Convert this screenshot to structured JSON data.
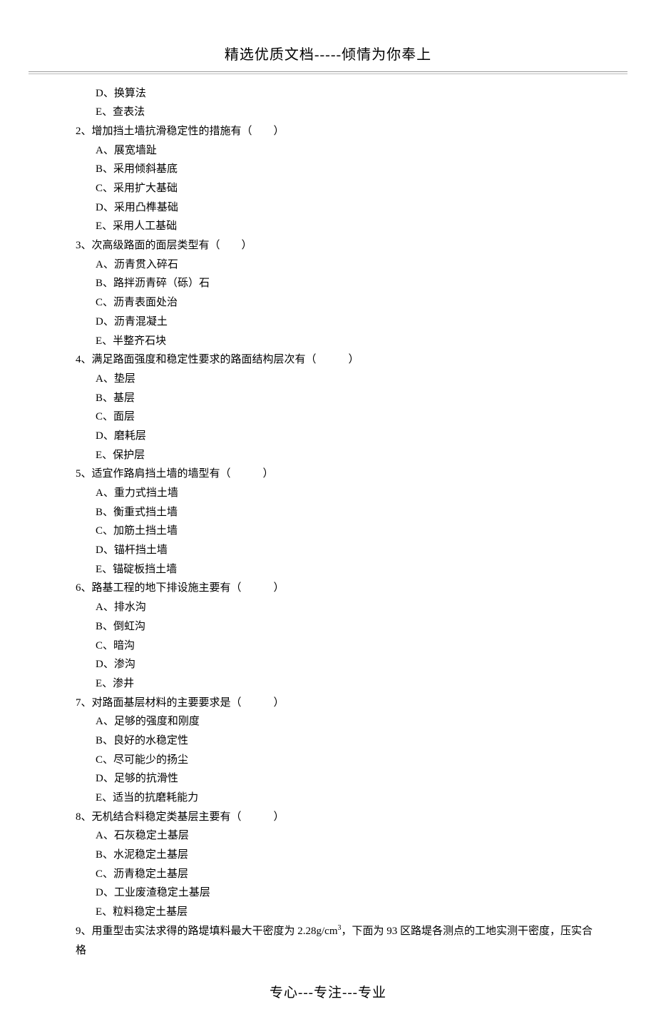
{
  "header": "精选优质文档-----倾情为你奉上",
  "footer": "专心---专注---专业",
  "leadingOptions": [
    "D、换算法",
    "E、查表法"
  ],
  "questions": [
    {
      "num": "2",
      "text": "增加挡土墙抗滑稳定性的措施有（　　）",
      "options": [
        "A、展宽墙趾",
        "B、采用倾斜基底",
        "C、采用扩大基础",
        "D、采用凸榫基础",
        "E、采用人工基础"
      ]
    },
    {
      "num": "3",
      "text": "次高级路面的面层类型有（　　）",
      "options": [
        "A、沥青贯入碎石",
        "B、路拌沥青碎（砾）石",
        "C、沥青表面处治",
        "D、沥青混凝土",
        "E、半整齐石块"
      ]
    },
    {
      "num": "4",
      "text": "满足路面强度和稳定性要求的路面结构层次有（　　　）",
      "options": [
        "A、垫层",
        "B、基层",
        "C、面层",
        "D、磨耗层",
        "E、保护层"
      ]
    },
    {
      "num": "5",
      "text": "适宜作路肩挡土墙的墙型有（　　　）",
      "options": [
        "A、重力式挡土墙",
        "B、衡重式挡土墙",
        "C、加筋土挡土墙",
        "D、锚杆挡土墙",
        "E、锚碇板挡土墙"
      ]
    },
    {
      "num": "6",
      "text": "路基工程的地下排设施主要有（　　　）",
      "options": [
        "A、排水沟",
        "B、倒虹沟",
        "C、暗沟",
        "D、渗沟",
        "E、渗井"
      ]
    },
    {
      "num": "7",
      "text": "对路面基层材料的主要要求是（　　　）",
      "options": [
        "A、足够的强度和刚度",
        "B、良好的水稳定性",
        "C、尽可能少的扬尘",
        "D、足够的抗滑性",
        "E、适当的抗磨耗能力"
      ]
    },
    {
      "num": "8",
      "text": "无机结合料稳定类基层主要有（　　　）",
      "options": [
        "A、石灰稳定土基层",
        "B、水泥稳定土基层",
        "C、沥青稳定土基层",
        "D、工业废渣稳定土基层",
        "E、粒料稳定土基层"
      ]
    }
  ],
  "lastQuestion": {
    "num": "9",
    "before": "用重型击实法求得的路堤填料最大干密度为 2.28g/cm",
    "sup": "3",
    "after": "，下面为 93 区路堤各测点的工地实测干密度，压实合格"
  }
}
